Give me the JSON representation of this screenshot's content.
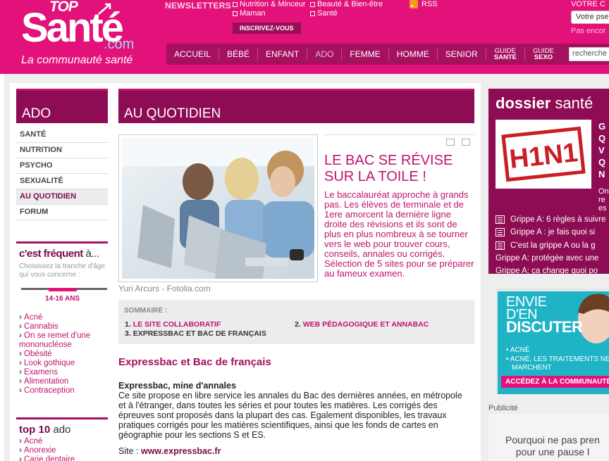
{
  "header": {
    "logo_top": "TOP",
    "logo_sante": "Santé",
    "logo_com": ".com",
    "logo_tagline": "La communauté santé",
    "newsletters_label": "NEWSLETTERS",
    "newsletter_options": [
      "Nutrition & Minceur",
      "Beauté & Bien-être",
      "Maman",
      "Santé"
    ],
    "subscribe_label": "INSCRIVEZ-VOUS",
    "rss_label": "RSS",
    "account_label": "VOTRE C",
    "account_input_placeholder": "Votre pse",
    "account_signup_text": "Pas encor",
    "nav": [
      "ACCUEIL",
      "BÉBÉ",
      "ENFANT",
      "ADO",
      "FEMME",
      "HOMME",
      "SENIOR"
    ],
    "nav_active": "ADO",
    "nav_guide_sante": [
      "GUIDE",
      "SANTÉ"
    ],
    "nav_guide_sexo": [
      "GUIDE",
      "SEXO"
    ],
    "search_placeholder": "recherche"
  },
  "left": {
    "title": "ADO",
    "items": [
      "SANTÉ",
      "NUTRITION",
      "PSYCHO",
      "SEXUALITÉ",
      "AU QUOTIDIEN",
      "FORUM"
    ],
    "active_item": "AU QUOTIDIEN",
    "frequent_title_bold": "c'est fréquent",
    "frequent_title_rest": "à...",
    "frequent_subtitle": "Choisissez la tranche d'âge qui vous concerne :",
    "age_range": "14-16 ANS",
    "frequent_items": [
      "Acné",
      "Cannabis",
      "On se remet d'une",
      "mononucléose",
      "Obésité",
      "Look gothique",
      "Examens",
      "Alimentation",
      "Contraception"
    ],
    "top10_bold": "top 10",
    "top10_rest": "ado",
    "top10_items": [
      "Acné",
      "Anorexie",
      "Carie dentaire"
    ]
  },
  "article": {
    "section_title": "AU QUOTIDIEN",
    "photo_credit": "Yuri Arcurs - Fotolia.com",
    "headline": "LE BAC SE RÉVISE SUR LA TOILE !",
    "chapo": "Le baccalauréat approche à grands pas. Les élèves de terminale et de 1ere amorcent la dernière ligne droite des révisions et ils sont de plus en plus nombreux à se tourner vers le web pour trouver cours, conseils, annales ou corrigés. Sélection de 5 sites pour se préparer au fameux examen.",
    "sommaire_label": "SOMMAIRE :",
    "sommaire": [
      {
        "num": "1.",
        "label": "LE SITE COLLABORATIF"
      },
      {
        "num": "2.",
        "label": "WEB PÉDAGOGIQUE ET ANNABAC"
      },
      {
        "num": "3.",
        "label": "EXPRESSBAC ET BAC DE FRANÇAIS"
      }
    ],
    "part_title": "Expressbac et Bac de français",
    "sub_title": "Expressbac, mine d'annales",
    "body": "Ce site propose en libre service les annales du Bac des dernières années, en métropole et à l'étranger, dans toutes les séries et pour toutes les matières. Les corrigés des épreuves sont proposés dans la plupart des cas. Egalement disponibles, les travaux pratiques corrigés pour les matières scientifiques, ainsi que les fonds de cartes en géographie pour les sections S et ES.",
    "site_label": "Site :",
    "site_url": "www.expressbac.fr"
  },
  "right": {
    "dossier_bold": "dossier",
    "dossier_rest": "santé",
    "h1n1_label": "H1N1",
    "side_lines": [
      "G",
      "Q",
      "V",
      "Q",
      "N"
    ],
    "side_small": [
      "On",
      "re",
      "es"
    ],
    "links": [
      "Grippe A: 6 règles à suivre",
      "Grippe A : je fais quoi si",
      "C'est la grippe A ou la g"
    ],
    "plain_links": [
      "Grippe A: protégée avec une",
      "Grippe A: ça change quoi po"
    ],
    "envie_line1": "ENVIE",
    "envie_line2": "D'EN",
    "envie_line3": "DISCUTER",
    "envie_bullets": [
      "• ACNÉ",
      "• ACNÉ, LES TRAITEMENTS NE",
      "MARCHENT"
    ],
    "envie_cta": "ACCÉDEZ À LA COMMUNAUTÉ",
    "pub_label": "Publicité",
    "promo_line1": "Pourquoi ne pas pren",
    "promo_line2": "pour une pause l"
  },
  "colors": {
    "brand_pink": "#e2127a",
    "dark_plum": "#8e0c53",
    "nav_plum": "#a5105f",
    "teal": "#1fb3c6"
  }
}
